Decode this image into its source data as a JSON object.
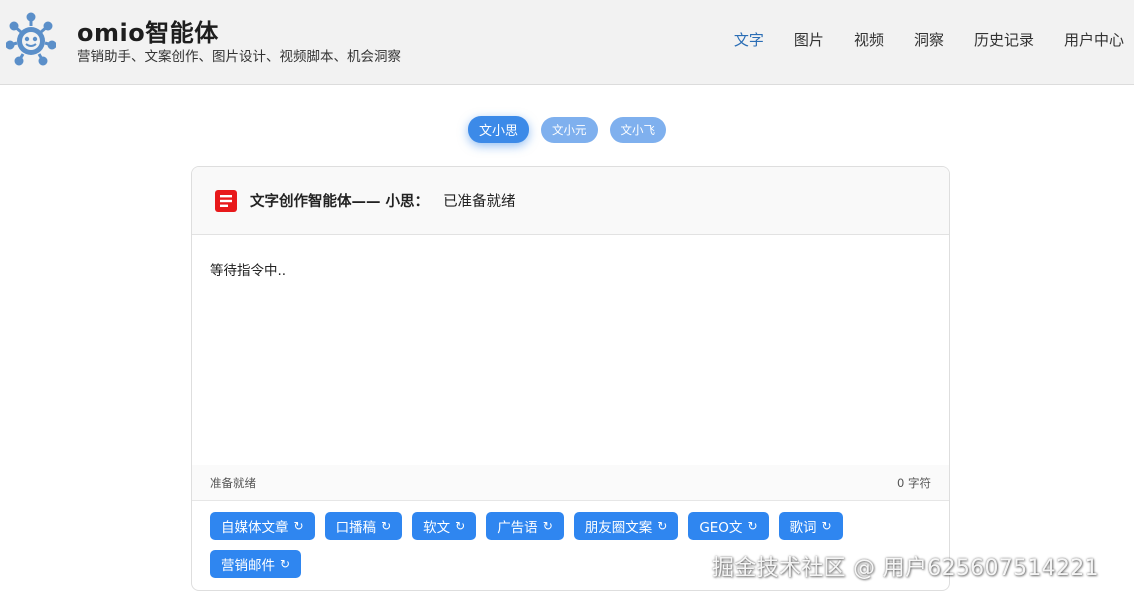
{
  "header": {
    "title": "omio智能体",
    "subtitle": "营销助手、文案创作、图片设计、视频脚本、机会洞察",
    "logo_icon": "robot-network-icon",
    "nav": [
      "文字",
      "图片",
      "视频",
      "洞察",
      "历史记录",
      "用户中心"
    ],
    "active_nav": "文字",
    "accent_color": "#2a6db5"
  },
  "agents": {
    "tabs": [
      "文小思",
      "文小元",
      "文小飞"
    ],
    "active": "文小思"
  },
  "card": {
    "icon": "document-icon",
    "title": "文字创作智能体—— 小思：",
    "status": "已准备就绪",
    "body_text": "等待指令中..",
    "footer_status": "准备就绪",
    "char_count": "0 字符"
  },
  "actions": [
    {
      "label": "自媒体文章",
      "icon": "↻"
    },
    {
      "label": "口播稿",
      "icon": "↻"
    },
    {
      "label": "软文",
      "icon": "↻"
    },
    {
      "label": "广告语",
      "icon": "↻"
    },
    {
      "label": "朋友圈文案",
      "icon": "↻"
    },
    {
      "label": "GEO文",
      "icon": "↻"
    },
    {
      "label": "歌词",
      "icon": "↻"
    },
    {
      "label": "营销邮件",
      "icon": "↻"
    }
  ],
  "button_color": "#2f86f0",
  "watermark": "掘金技术社区 @ 用户625607514221"
}
